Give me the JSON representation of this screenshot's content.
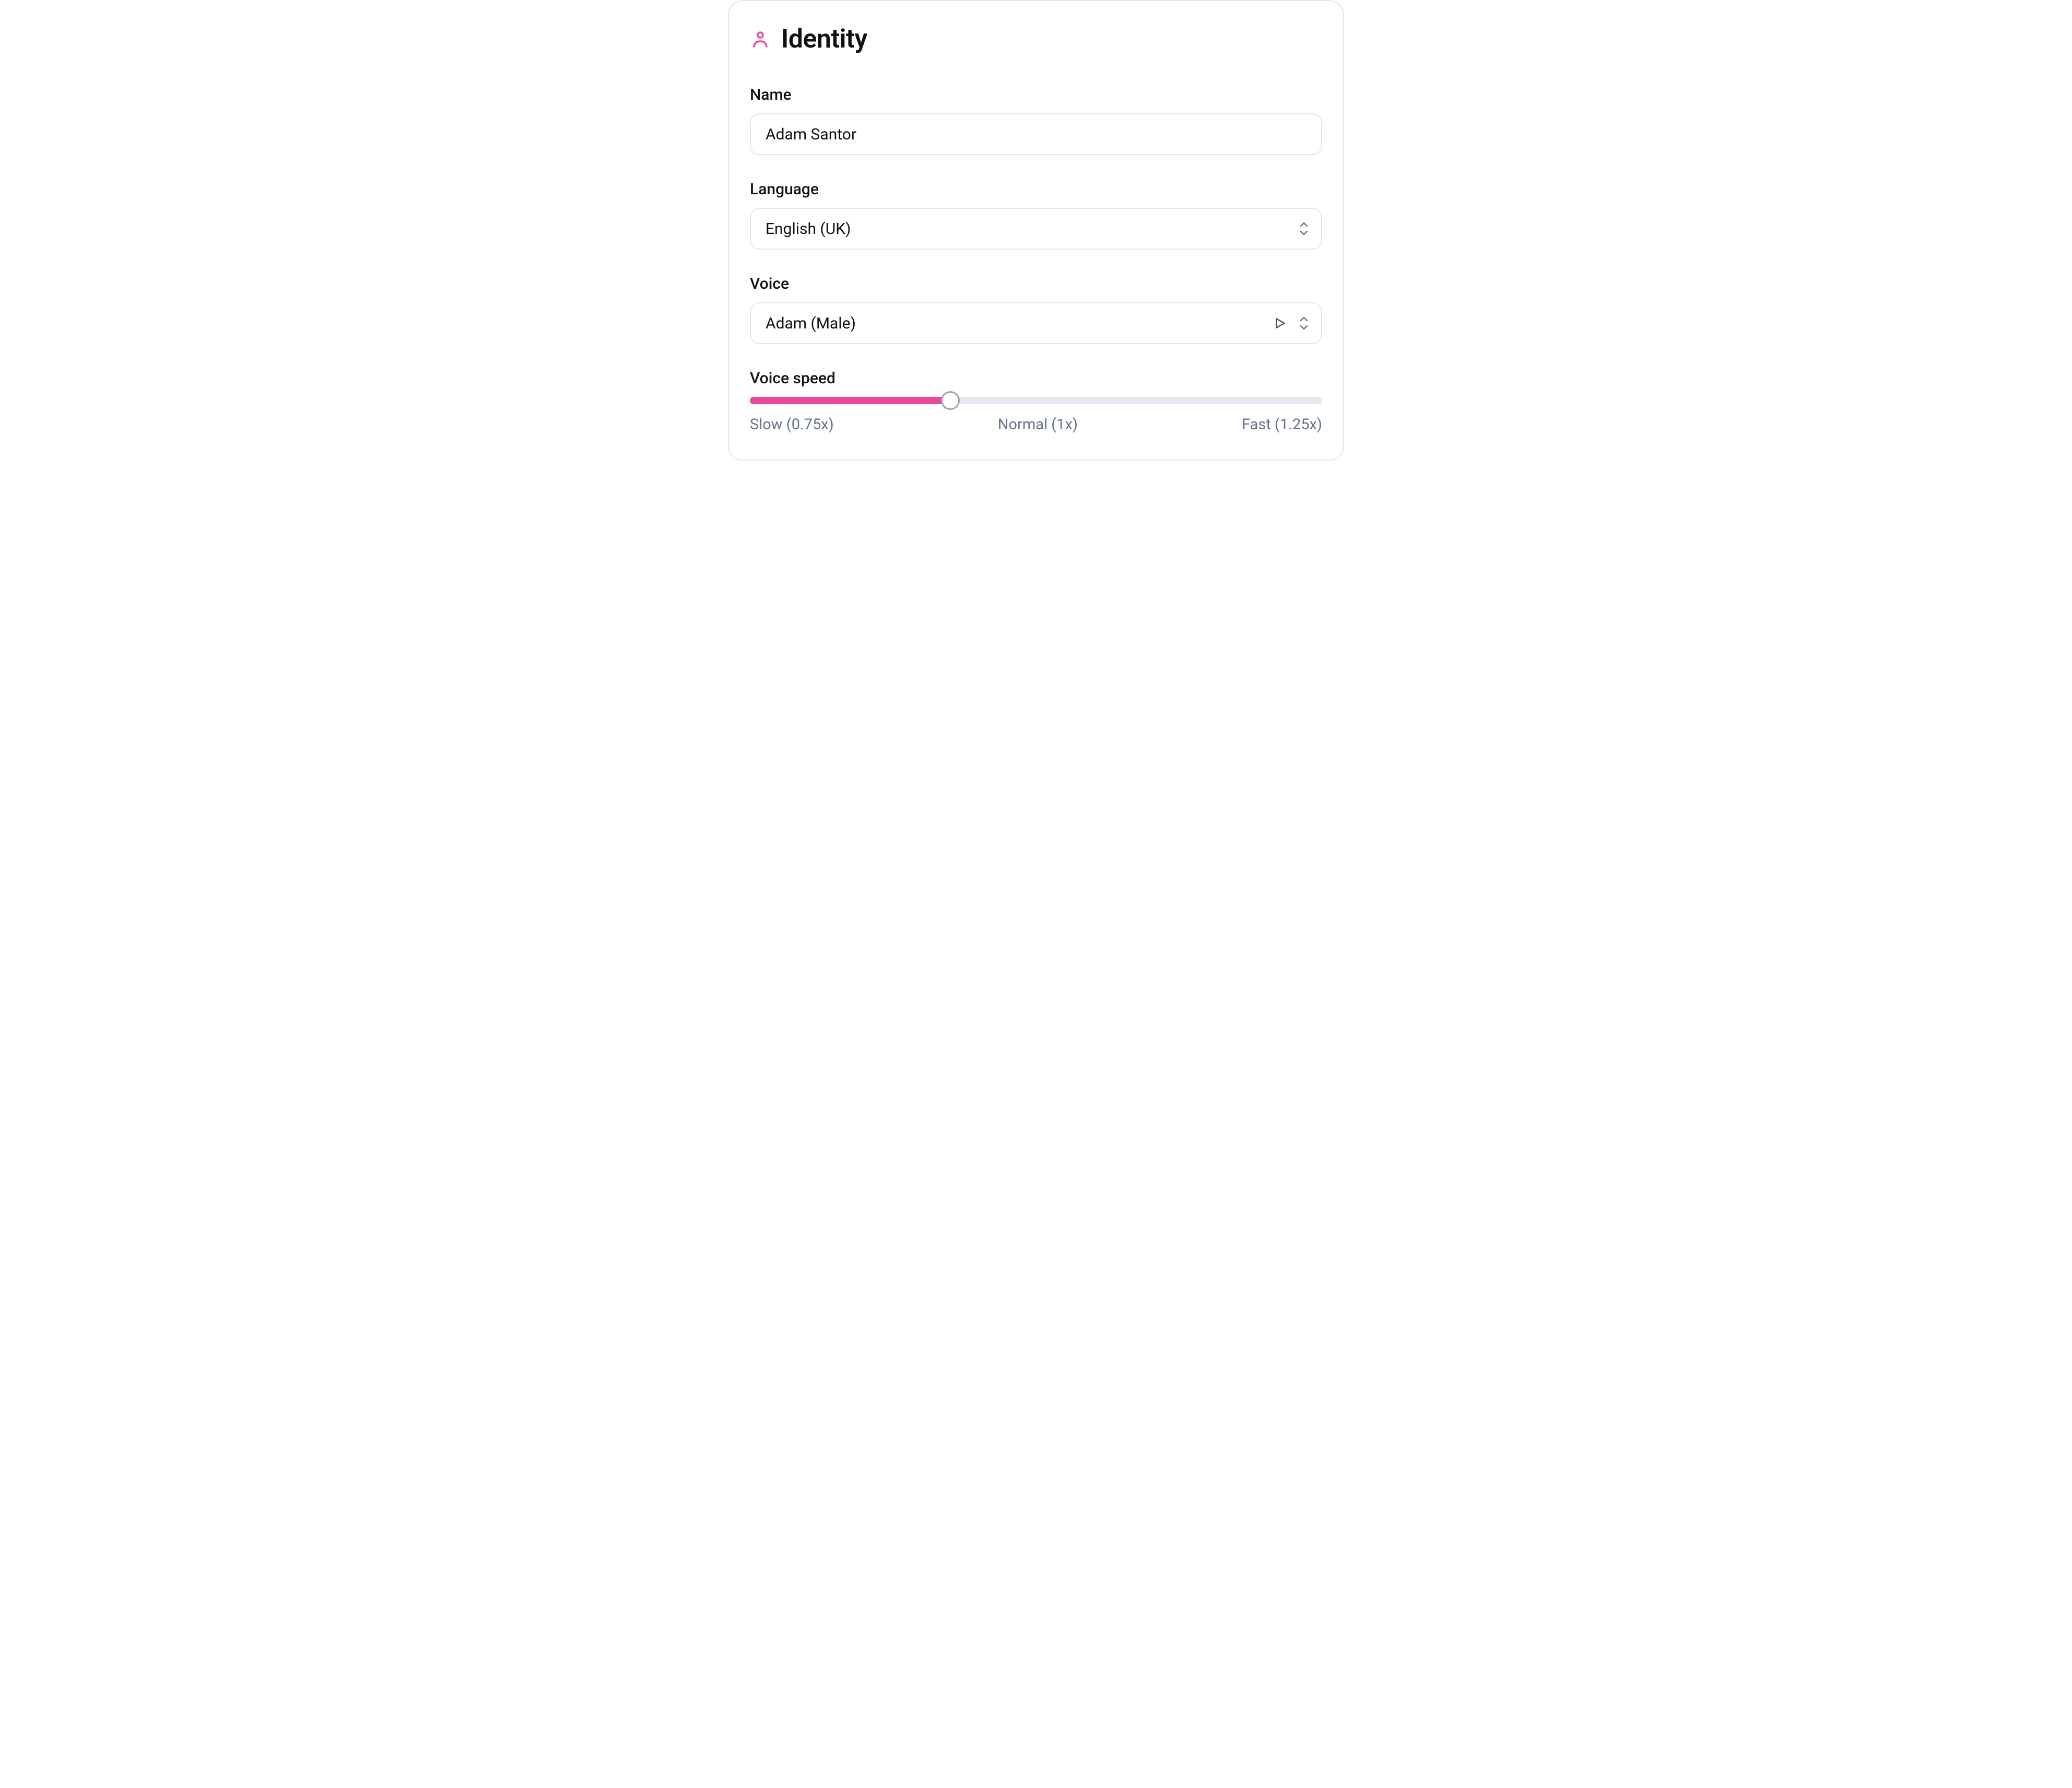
{
  "colors": {
    "accent": "#ec4899",
    "border": "#e2e8f0",
    "text": "#111111",
    "muted": "#64748b",
    "track": "#e2e8f0"
  },
  "identity": {
    "section_title": "Identity",
    "name": {
      "label": "Name",
      "value": "Adam Santor"
    },
    "language": {
      "label": "Language",
      "value": "English (UK)"
    },
    "voice": {
      "label": "Voice",
      "value": "Adam (Male)"
    },
    "voice_speed": {
      "label": "Voice speed",
      "value_percent": 35,
      "ticks": {
        "slow": "Slow (0.75x)",
        "normal": "Normal (1x)",
        "fast": "Fast (1.25x)"
      }
    }
  }
}
